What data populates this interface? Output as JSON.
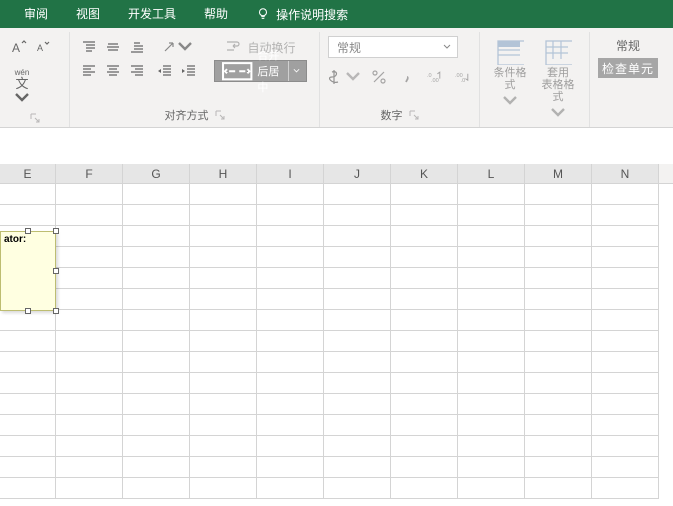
{
  "menubar": {
    "review": "审阅",
    "view": "视图",
    "devtools": "开发工具",
    "help": "帮助",
    "tellme": "操作说明搜索"
  },
  "ribbon": {
    "alignment_label": "对齐方式",
    "number_label": "数字",
    "wrap_text": "自动换行",
    "merge_center": "合并后居中",
    "number_format": "常规",
    "pinyinLabel": "wén",
    "pinyinChar": "文",
    "cond_format": "条件格式",
    "table_format": "套用\n表格格式",
    "normal_style": "常规",
    "check_cell": "检查单元"
  },
  "columns": [
    "E",
    "F",
    "G",
    "H",
    "I",
    "J",
    "K",
    "L",
    "M",
    "N"
  ],
  "comment": {
    "author": "ator:"
  }
}
